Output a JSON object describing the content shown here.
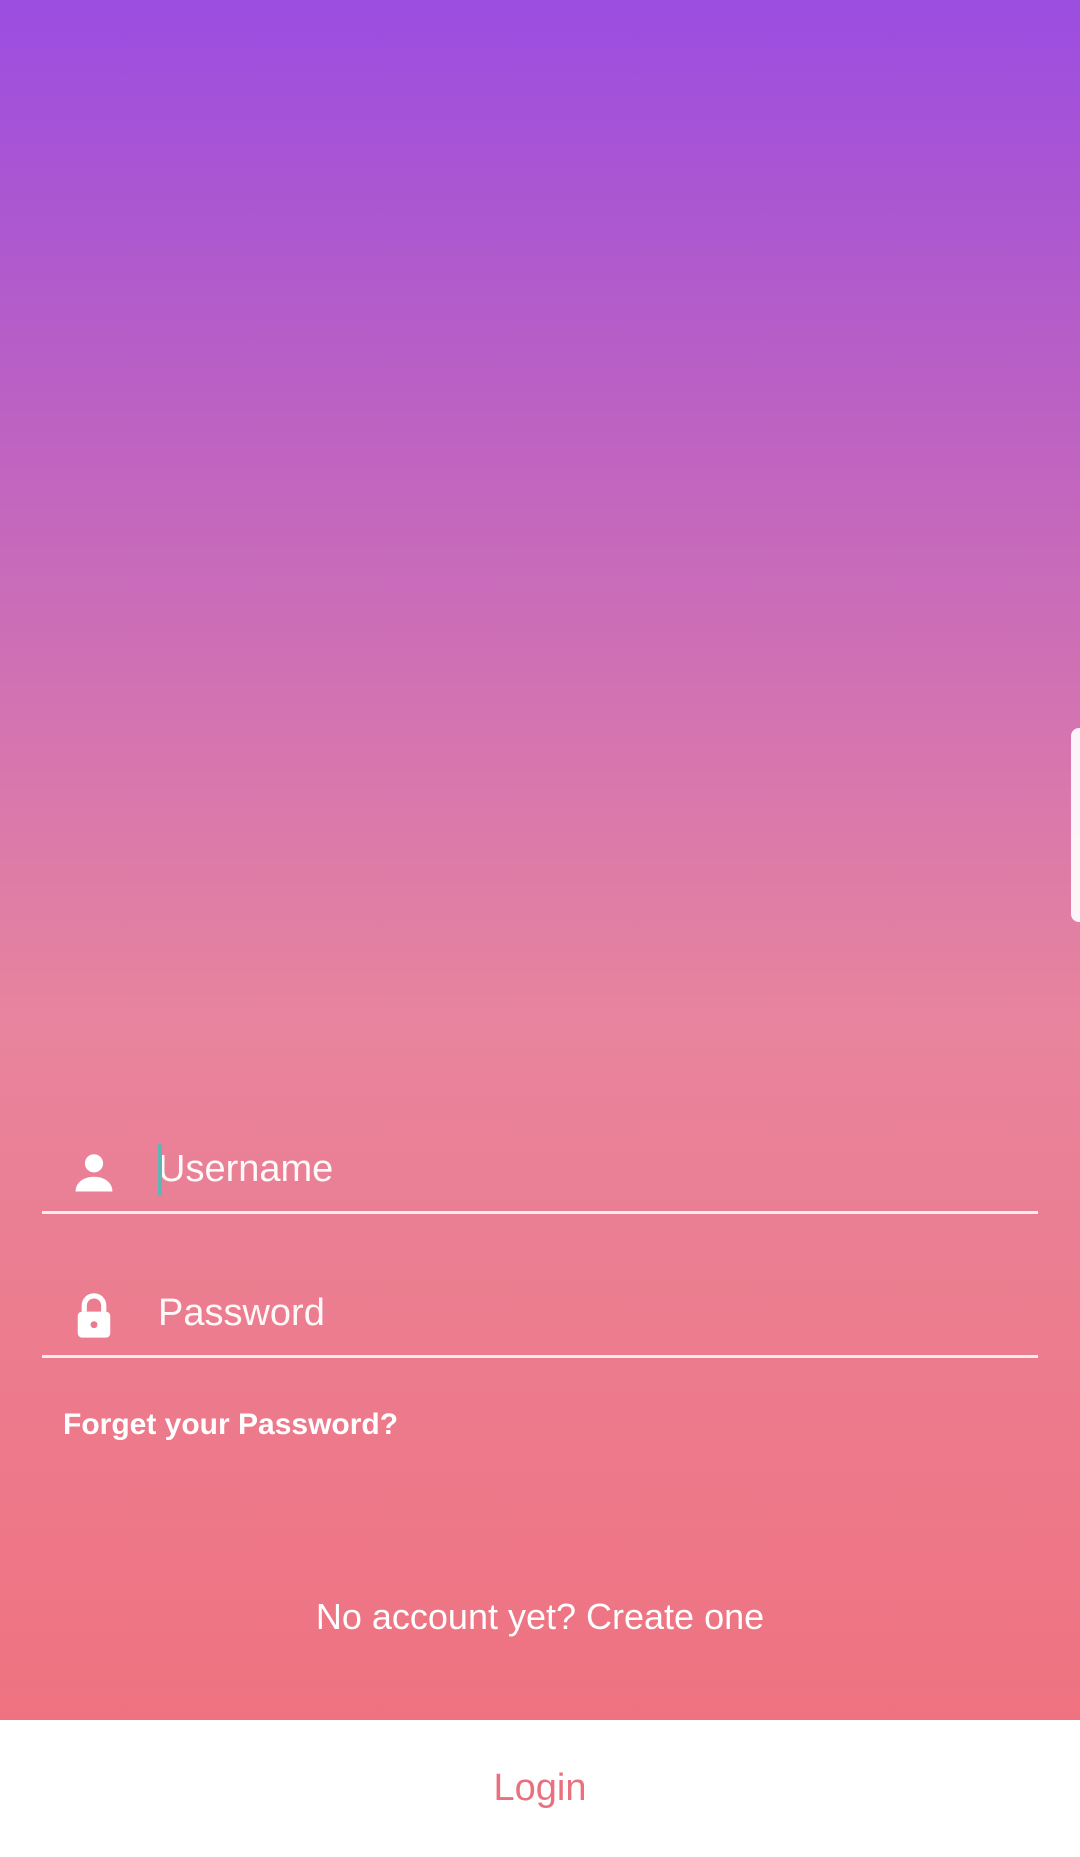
{
  "form": {
    "username": {
      "placeholder": "Username",
      "value": "",
      "icon": "person-icon"
    },
    "password": {
      "placeholder": "Password",
      "value": "",
      "icon": "lock-icon"
    },
    "forgot_label": "Forget your Password?",
    "create_account_label": "No account yet? Create one"
  },
  "login_button": {
    "label": "Login"
  },
  "colors": {
    "gradient_top": "#9b4de0",
    "gradient_bottom": "#f06f7c",
    "accent_text": "#e9707e",
    "caret": "#5fb6b4"
  }
}
